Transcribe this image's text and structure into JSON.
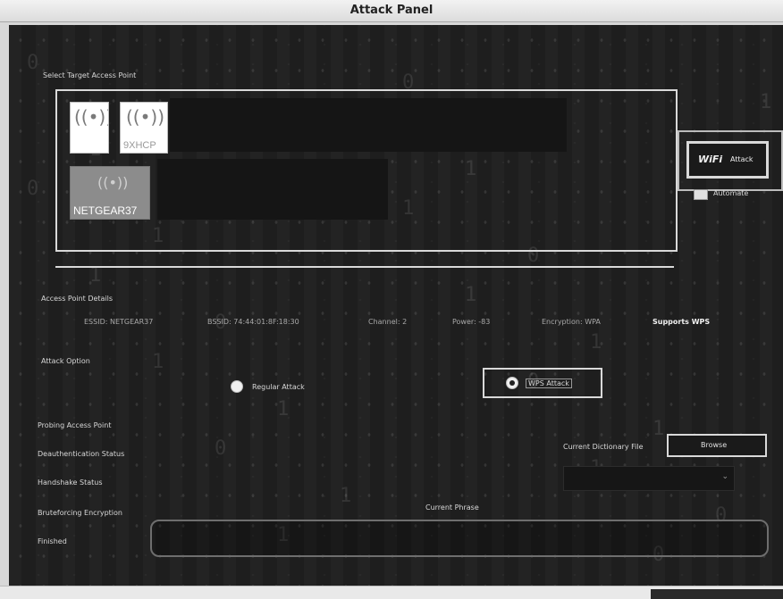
{
  "window": {
    "title": "Attack Panel"
  },
  "target": {
    "section_label": "Select Target Access Point",
    "access_points": [
      {
        "name": ""
      },
      {
        "name": "9XHCP"
      },
      {
        "name": "NETGEAR37"
      }
    ]
  },
  "attack_button": {
    "icon_text": "WiFi",
    "label": "Attack"
  },
  "automate": {
    "label": "Automate",
    "checked": false
  },
  "details": {
    "section_label": "Access Point Details",
    "essid": "ESSID:  NETGEAR37",
    "bssid": "BSSID:  74:44:01:8F:18:30",
    "channel": "Channel:  2",
    "power": "Power:  -83",
    "encryption": "Encryption:  WPA",
    "wps": "Supports WPS"
  },
  "attack_option": {
    "section_label": "Attack Option",
    "regular_label": "Regular Attack",
    "wps_label": "WPS Attack",
    "selected": "WPS Attack"
  },
  "status": {
    "probing": "Probing Access Point",
    "deauth": "Deauthentication Status",
    "handshake": "Handshake Status",
    "bruteforce": "Bruteforcing Encryption",
    "finished": "Finished"
  },
  "dictionary": {
    "label": "Current Dictionary File",
    "browse_label": "Browse"
  },
  "phrase": {
    "label": "Current Phrase",
    "value": ""
  },
  "background_digits": [
    "0",
    "1",
    "1",
    "0",
    "1",
    "1",
    "0",
    "1",
    "0",
    "1",
    "1",
    "0",
    "1",
    "0",
    "1",
    "1",
    "0",
    "1",
    "0",
    "1",
    "1",
    "0",
    "1",
    "0"
  ],
  "colors": {
    "panel_bg": "#1e1e1e",
    "highlight_border": "#d9d9d9",
    "title_bg": "#e8e8e8"
  }
}
